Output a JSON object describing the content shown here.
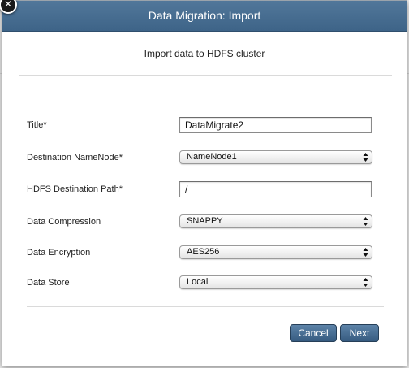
{
  "dialog": {
    "title": "Data Migration: Import",
    "subtitle": "Import data to HDFS cluster",
    "close_symbol": "✕"
  },
  "form": {
    "title": {
      "label": "Title*",
      "value": "DataMigrate2"
    },
    "destination_namenode": {
      "label": "Destination NameNode*",
      "value": "NameNode1"
    },
    "hdfs_path": {
      "label": "HDFS Destination Path*",
      "value": "/"
    },
    "compression": {
      "label": "Data Compression",
      "value": "SNAPPY"
    },
    "encryption": {
      "label": "Data Encryption",
      "value": "AES256"
    },
    "store": {
      "label": "Data Store",
      "value": "Local"
    }
  },
  "buttons": {
    "cancel": "Cancel",
    "next": "Next"
  },
  "icons": {
    "close": "close-icon",
    "select_arrows": "updown-arrows-icon"
  },
  "colors": {
    "header": "#46698d",
    "button": "#4a6f94"
  }
}
